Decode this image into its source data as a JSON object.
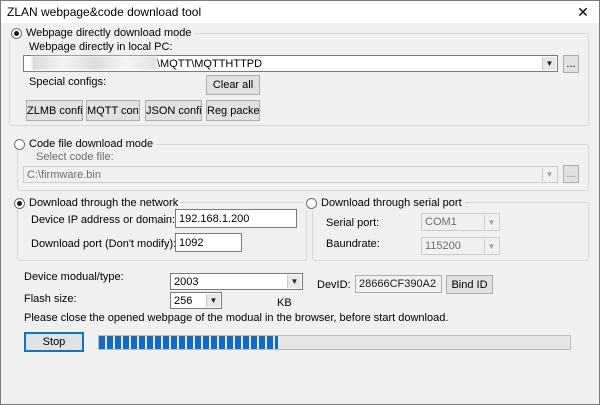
{
  "window": {
    "title": "ZLAN webpage&code download tool",
    "close_glyph": "✕"
  },
  "webpage_mode": {
    "label": "Webpage directly download mode",
    "selected": true,
    "path_label": "Webpage directly in local PC:",
    "path_value": "\\MQTT\\MQTTHTTPD",
    "browse_label": "...",
    "special_configs_label": "Special configs:",
    "clear_all_label": "Clear all",
    "buttons": [
      "ZLMB config",
      "MQTT config",
      "JSON config",
      "Reg packet"
    ]
  },
  "code_mode": {
    "label": "Code file download mode",
    "selected": false,
    "select_label": "Select code file:",
    "file_value": "C:\\firmware.bin",
    "browse_label": "..."
  },
  "network": {
    "label": "Download through the network",
    "selected": true,
    "ip_label": "Device IP address or domain:",
    "ip_value": "192.168.1.200",
    "port_label": "Download port (Don't modify):",
    "port_value": "1092"
  },
  "serial": {
    "label": "Download through serial port",
    "selected": false,
    "port_label": "Serial port:",
    "port_value": "COM1",
    "baud_label": "Baundrate:",
    "baud_value": "115200"
  },
  "device": {
    "type_label": "Device modual/type:",
    "type_value": "2003",
    "flash_label": "Flash size:",
    "flash_value": "256",
    "flash_unit": "KB",
    "devid_label": "DevID:",
    "devid_value": "28666CF390A2",
    "bind_label": "Bind ID"
  },
  "notice": "Please close the opened webpage of the modual in the browser, before start download.",
  "stop_label": "Stop",
  "progress": {
    "fraction": 0.38
  }
}
